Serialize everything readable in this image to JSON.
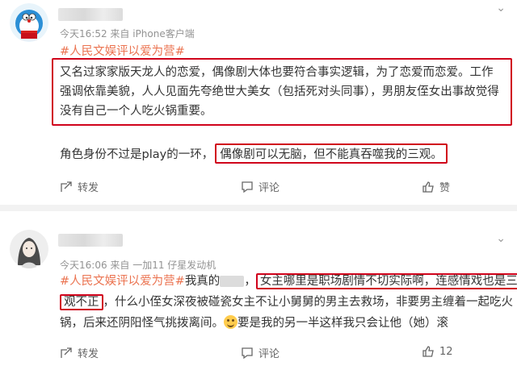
{
  "post1": {
    "meta": "今天16:52 来自 iPhone客户端",
    "hashtag": "#人民文娱评以爱为营#",
    "paragraph": "又名过家家版天龙人的恋爱，偶像剧大体也要符合事实逻辑，为了恋爱而恋爱。工作强调依靠美貌，人人见面先夸绝世大美女（包括死对头同事），男朋友侄女出事故觉得没有自己一个人吃火锅重要。",
    "second_line_prefix": "角色身份不过是play的一环，",
    "second_line_highlight": "偶像剧可以无脑，但不能真吞噬我的三观。",
    "actions": {
      "forward": "转发",
      "comment": "评论",
      "like": "赞"
    }
  },
  "post2": {
    "meta": "今天16:06 来自 一加11 仔星发动机",
    "hashtag": "#人民文娱评以爱为营#",
    "line1_prefix": "我真的",
    "line1_highlight": "女主哪里是职场剧情不切实际啊，连感情戏也是三",
    "line2_highlight": "观不正",
    "line2_rest": "，什么小侄女深夜被碰瓷女主不让小舅舅的男主去救场，非要男主缠着一起吃火",
    "line3_a": "锅，后来还阴阳怪气挑拨离间。",
    "line3_b": "要是我的另一半这样我只会让他（她）滚",
    "actions": {
      "forward": "转发",
      "comment": "评论",
      "like_count": "12"
    }
  }
}
